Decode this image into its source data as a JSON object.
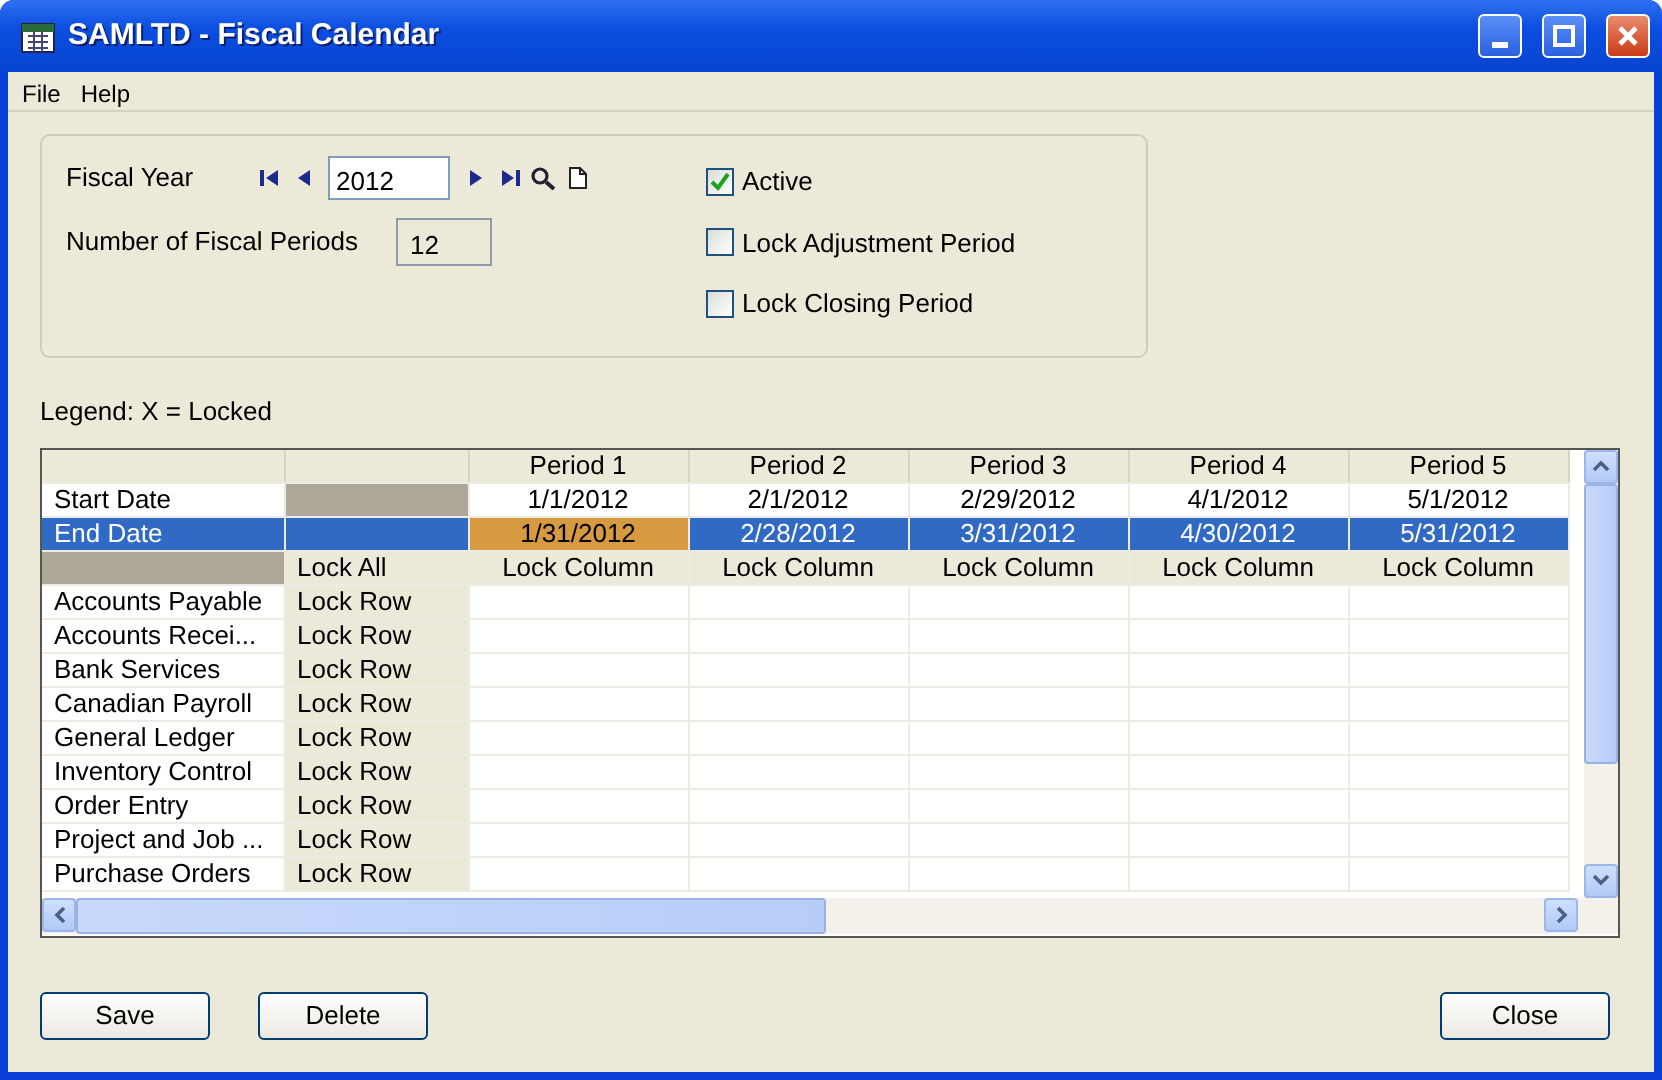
{
  "window": {
    "title": "SAMLTD - Fiscal Calendar"
  },
  "menu": [
    "File",
    "Help"
  ],
  "header": {
    "fiscal_year_label": "Fiscal Year",
    "fiscal_year": "2012",
    "periods_label": "Number of Fiscal Periods",
    "periods": "12",
    "checkboxes": [
      {
        "label": "Active",
        "checked": true
      },
      {
        "label": "Lock Adjustment Period",
        "checked": false
      },
      {
        "label": "Lock Closing Period",
        "checked": false
      }
    ]
  },
  "legend": "Legend: X = Locked",
  "grid": {
    "columns": [
      "Period 1",
      "Period 2",
      "Period 3",
      "Period 4",
      "Period 5"
    ],
    "date_rows": [
      {
        "label": "Start Date",
        "selected": false,
        "cells": [
          {
            "text": "1/1/2012",
            "current": false
          },
          {
            "text": "2/1/2012",
            "current": false
          },
          {
            "text": "2/29/2012",
            "current": false
          },
          {
            "text": "4/1/2012",
            "current": false
          },
          {
            "text": "5/1/2012",
            "current": false
          }
        ]
      },
      {
        "label": "End Date",
        "selected": true,
        "cells": [
          {
            "text": "1/31/2012",
            "current": true
          },
          {
            "text": "2/28/2012",
            "current": false
          },
          {
            "text": "3/31/2012",
            "current": false
          },
          {
            "text": "4/30/2012",
            "current": false
          },
          {
            "text": "5/31/2012",
            "current": false
          }
        ]
      }
    ],
    "lock_all": "Lock All",
    "lock_columns": [
      "Lock Column",
      "Lock Column",
      "Lock Column",
      "Lock Column",
      "Lock Column"
    ],
    "rows": [
      {
        "label": "Accounts Payable",
        "lock": "Lock Row"
      },
      {
        "label": "Accounts Recei...",
        "lock": "Lock Row"
      },
      {
        "label": "Bank Services",
        "lock": "Lock Row"
      },
      {
        "label": "Canadian Payroll",
        "lock": "Lock Row"
      },
      {
        "label": "General Ledger",
        "lock": "Lock Row"
      },
      {
        "label": "Inventory Control",
        "lock": "Lock Row"
      },
      {
        "label": "Order Entry",
        "lock": "Lock Row"
      },
      {
        "label": "Project and Job ...",
        "lock": "Lock Row"
      },
      {
        "label": "Purchase Orders",
        "lock": "Lock Row"
      }
    ]
  },
  "buttons": [
    {
      "label": "Save",
      "kind": "left"
    },
    {
      "label": "Delete",
      "kind": "left"
    },
    {
      "label": "Close",
      "kind": "right"
    }
  ]
}
